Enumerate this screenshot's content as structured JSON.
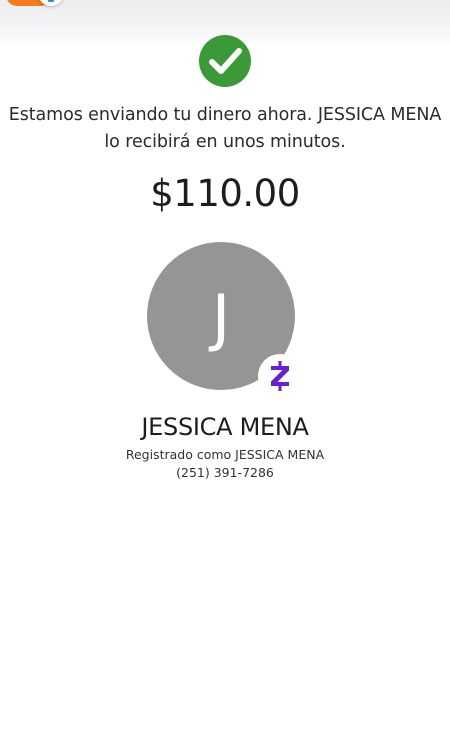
{
  "header": {
    "status_icon": "check-circle-icon",
    "accent_color": "#3a9a37"
  },
  "confirmation": {
    "message_line1": "Estamos enviando tu dinero ahora. JESSICA MENA",
    "message_line2": "lo recibirá en unos minutos.",
    "amount": "$110.00"
  },
  "recipient": {
    "initial": "J",
    "name": "JESSICA MENA",
    "registered_as": "Registrado como JESSICA MENA",
    "phone": "(251) 391-7286",
    "avatar_color": "#959595",
    "network_badge_icon": "zelle-icon",
    "network_badge_color": "#6d1ed4"
  }
}
